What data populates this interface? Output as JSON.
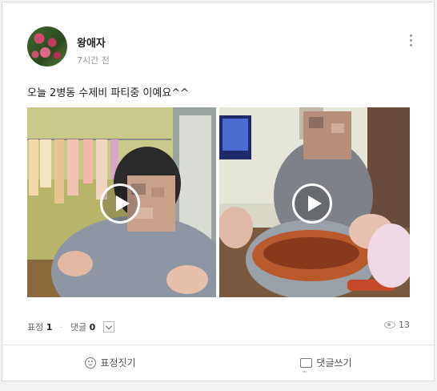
{
  "post": {
    "author": "왕애자",
    "time": "7시간 전",
    "text": "오늘 2병동 수제비 파티중 이예요^^"
  },
  "stats": {
    "reaction_label": "표정",
    "reaction_count": "1",
    "comment_label": "댓글",
    "comment_count": "0",
    "views": "13"
  },
  "actions": {
    "react": "표정짓기",
    "comment": "댓글쓰기"
  },
  "icons": [
    "more-icon",
    "play-icon",
    "chevron-down-icon",
    "eye-icon",
    "smile-icon",
    "comment-icon"
  ]
}
